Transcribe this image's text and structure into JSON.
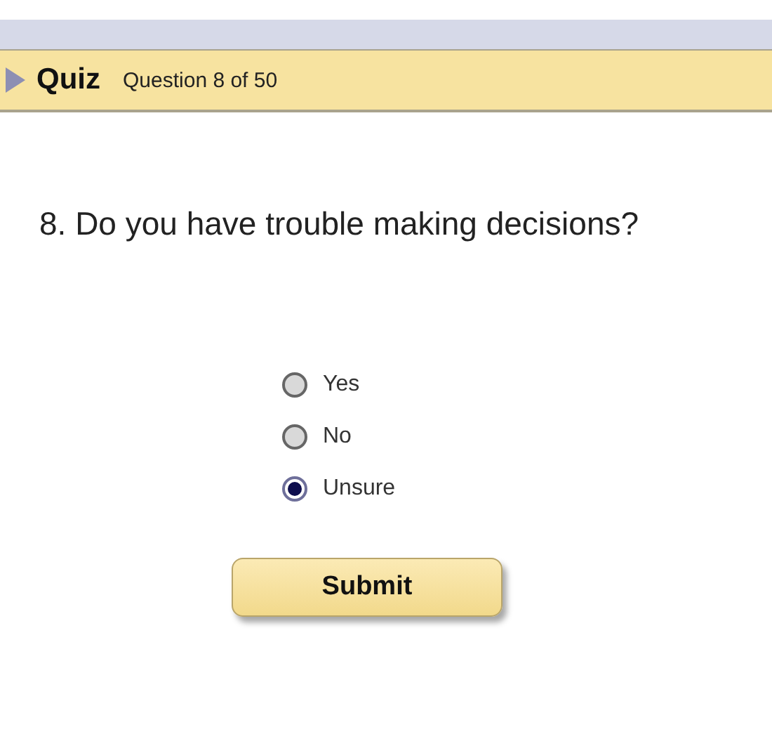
{
  "header": {
    "title": "Quiz",
    "progress": "Question 8 of 50"
  },
  "question": "8. Do you have trouble making decisions?",
  "options": [
    {
      "label": "Yes",
      "selected": false
    },
    {
      "label": "No",
      "selected": false
    },
    {
      "label": "Unsure",
      "selected": true
    }
  ],
  "submit": "Submit"
}
